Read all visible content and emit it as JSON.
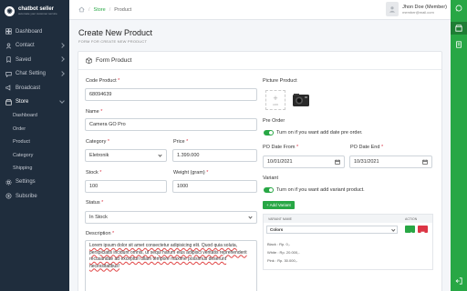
{
  "brand": {
    "name": "chatbot seller",
    "subtitle": "automate your customer service"
  },
  "sidebar": {
    "items": [
      {
        "label": "Dashboard"
      },
      {
        "label": "Contact"
      },
      {
        "label": "Saved"
      },
      {
        "label": "Chat Setting"
      },
      {
        "label": "Broadcast"
      },
      {
        "label": "Store"
      }
    ],
    "store_sub": [
      "Dashboard",
      "Order",
      "Product",
      "Category",
      "Shipping"
    ],
    "bottom": [
      {
        "label": "Settings"
      },
      {
        "label": "Subsribe"
      }
    ]
  },
  "breadcrumb": {
    "sep1": "/",
    "store": "Store",
    "sep2": "/",
    "current": "Product"
  },
  "user": {
    "name": "Jhon Doe (Member)",
    "email": "member@mail.com"
  },
  "page": {
    "title": "Create New Product",
    "subtitle": "FORM FOR CREATE NEW PRODUCT"
  },
  "card": {
    "title": "Form Product"
  },
  "form": {
    "code_label": "Code Product",
    "code_value": "68094639",
    "name_label": "Name",
    "name_value": "Camera GO Pro",
    "category_label": "Category",
    "category_value": "Eletronik",
    "price_label": "Price",
    "price_value": "1.399.000",
    "stock_label": "Stock",
    "stock_value": "100",
    "weight_label": "Weight (gram)",
    "weight_value": "1000",
    "status_label": "Status",
    "status_value": "In Stock",
    "description_label": "Description",
    "description_value": "Lorem ipsum dolor sit amet consectetur adipisicing elit. Quod quia soluta, perspiciatis incidunt omnis, ut sequi harum eius adipisci veritatis reprehenderit recusandae ad excepturi ullam tempore maxime possimus deserunt necessitatibus!",
    "required_mark": "*",
    "picture_label": "Picture Product",
    "picture_add": "ADD",
    "preorder_label": "Pre Order",
    "preorder_toggle_text": "Turn on if you want add date pre order.",
    "po_start_label": "PO Date From",
    "po_start_value": "10/01/2021",
    "po_end_label": "PO Date End",
    "po_end_value": "10/31/2021",
    "variant_label": "Variant",
    "variant_toggle_text": "Turn on if you want add variant product.",
    "add_variant_button": "+ Add Variant"
  },
  "variant_table": {
    "headers": [
      "VARIANT NAME",
      "ACTION"
    ],
    "row": {
      "name": "Colors",
      "options": [
        "Black : Rp. 0,-",
        "White : Rp. 20.000,-",
        "Pink : Rp. 30.000,-"
      ]
    }
  },
  "colors": {
    "accent": "#28a745",
    "sidebar": "#1f2d3d",
    "danger": "#dc3545"
  }
}
